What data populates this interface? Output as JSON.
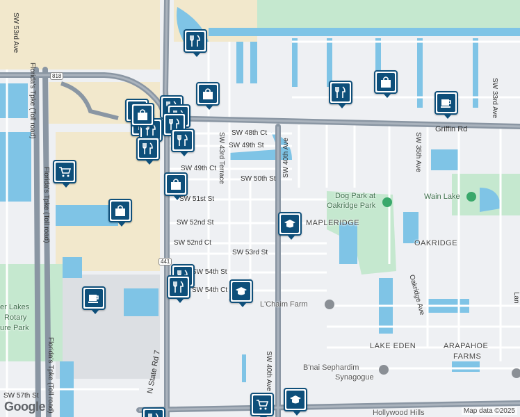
{
  "map": {
    "attribution": "Map data ©2025",
    "logo": "Google",
    "colors": {
      "water": "#7fc4e6",
      "park": "#c5e8cf",
      "major_road": "#8a96a3",
      "highway": "#5f6f80",
      "marker": "#0e4f7a",
      "land": "#eef0f3",
      "beige": "#f2e8cc"
    }
  },
  "road_labels": [
    {
      "text": "SW 53rd Ave"
    },
    {
      "text": "Florida's Tpke (Toll road)"
    },
    {
      "text": "Florida's Tpke (Toll road)"
    },
    {
      "text": "Florida's Tpke (Toll road)"
    },
    {
      "text": "SW 48th Ct"
    },
    {
      "text": "SW 49th St"
    },
    {
      "text": "SW 49th Ct"
    },
    {
      "text": "SW 50th St"
    },
    {
      "text": "SW 51st St"
    },
    {
      "text": "SW 52nd St"
    },
    {
      "text": "SW 52nd Ct"
    },
    {
      "text": "SW 53rd St"
    },
    {
      "text": "SW 54th St"
    },
    {
      "text": "SW 54th Ct"
    },
    {
      "text": "SW 57th St"
    },
    {
      "text": "SW 43rd Terrace"
    },
    {
      "text": "SW 40th Ave"
    },
    {
      "text": "SW 40th Ave"
    },
    {
      "text": "SW 35th Ave"
    },
    {
      "text": "SW 33rd Ave"
    },
    {
      "text": "Griffin Rd"
    },
    {
      "text": "N State Rd 7"
    },
    {
      "text": "Oakridge Ave"
    },
    {
      "text": "Lan"
    }
  ],
  "route_shields": [
    "818",
    "441",
    "848"
  ],
  "areas": [
    "MAPLERIDGE",
    "OAKRIDGE",
    "LAKE EDEN",
    "ARAPAHOE",
    "FARMS"
  ],
  "pois": [
    {
      "text": "Dog Park at",
      "kind": "park"
    },
    {
      "text": "Oakridge Park",
      "kind": "park"
    },
    {
      "text": "Wain Lake",
      "kind": "park"
    },
    {
      "text": "L'Chaim Farm",
      "kind": "place"
    },
    {
      "text": "B'nai Sephardim",
      "kind": "place"
    },
    {
      "text": "Synagogue",
      "kind": "place"
    },
    {
      "text": "er Lakes",
      "kind": "park"
    },
    {
      "text": "Rotary",
      "kind": "park"
    },
    {
      "text": "ure Park",
      "kind": "park"
    },
    {
      "text": "Hollywood Hills",
      "kind": "place"
    }
  ],
  "markers": [
    {
      "icon": "restaurant-icon"
    },
    {
      "icon": "shopping-bag-icon"
    },
    {
      "icon": "shopping-bag-icon"
    },
    {
      "icon": "restaurant-icon"
    },
    {
      "icon": "coffee-icon"
    },
    {
      "icon": "restaurant-icon"
    },
    {
      "icon": "restaurant-icon"
    },
    {
      "icon": "restaurant-icon"
    },
    {
      "icon": "restaurant-icon"
    },
    {
      "icon": "restaurant-icon"
    },
    {
      "icon": "restaurant-icon"
    },
    {
      "icon": "shopping-bag-icon"
    },
    {
      "icon": "restaurant-icon"
    },
    {
      "icon": "restaurant-icon"
    },
    {
      "icon": "shopping-bag-icon"
    },
    {
      "icon": "shopping-cart-icon"
    },
    {
      "icon": "shopping-bag-icon"
    },
    {
      "icon": "school-icon"
    },
    {
      "icon": "restaurant-icon"
    },
    {
      "icon": "restaurant-icon"
    },
    {
      "icon": "school-icon"
    },
    {
      "icon": "coffee-icon"
    },
    {
      "icon": "shopping-cart-icon"
    },
    {
      "icon": "school-icon"
    },
    {
      "icon": "restaurant-icon"
    }
  ]
}
